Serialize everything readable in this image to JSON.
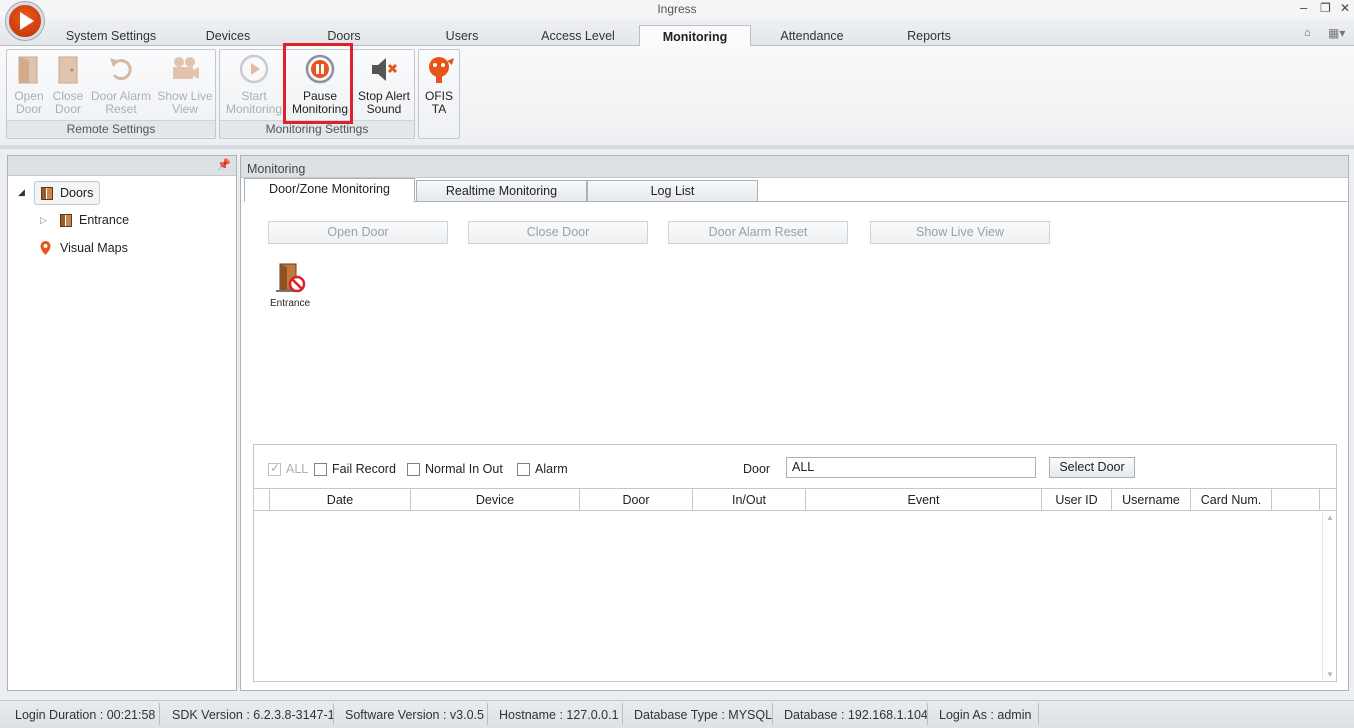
{
  "window": {
    "title": "Ingress",
    "minimize_glyph": "–",
    "restore_glyph": "❐",
    "close_glyph": "✕"
  },
  "ribbon_tabs": [
    "System Settings",
    "Devices",
    "Doors",
    "Users",
    "Access Level",
    "Monitoring",
    "Attendance",
    "Reports"
  ],
  "active_ribbon_tab": "Monitoring",
  "ribbon": {
    "remote_settings": {
      "label": "Remote Settings",
      "buttons": [
        {
          "line1": "Open",
          "line2": "Door",
          "icon": "open-door-icon",
          "enabled": false
        },
        {
          "line1": "Close",
          "line2": "Door",
          "icon": "close-door-icon",
          "enabled": false
        },
        {
          "line1": "Door Alarm",
          "line2": "Reset",
          "icon": "reset-icon",
          "enabled": false
        },
        {
          "line1": "Show Live",
          "line2": "View",
          "icon": "camera-icon",
          "enabled": false
        }
      ]
    },
    "monitoring_settings": {
      "label": "Monitoring Settings",
      "buttons": [
        {
          "line1": "Start",
          "line2": "Monitoring",
          "icon": "play-icon",
          "enabled": false
        },
        {
          "line1": "Pause",
          "line2": "Monitoring",
          "icon": "pause-icon",
          "enabled": true
        },
        {
          "line1": "Stop Alert",
          "line2": "Sound",
          "icon": "mute-icon",
          "enabled": true
        }
      ]
    },
    "ofis": {
      "line1": "OFIS",
      "line2": "TA",
      "icon": "ofis-ta-icon"
    }
  },
  "tree": {
    "root": "Doors",
    "child": "Entrance",
    "maps": "Visual Maps"
  },
  "main": {
    "header": "Monitoring",
    "tabs": [
      "Door/Zone Monitoring",
      "Realtime Monitoring",
      "Log List"
    ],
    "actions": [
      "Open Door",
      "Close Door",
      "Door Alarm Reset",
      "Show Live View"
    ],
    "door_tile": "Entrance",
    "filters": {
      "all": "ALL",
      "fail": "Fail Record",
      "normal": "Normal In Out",
      "alarm": "Alarm",
      "door_label": "Door",
      "door_value": "ALL",
      "select_door": "Select Door"
    },
    "columns": [
      "Date",
      "Device",
      "Door",
      "In/Out",
      "Event",
      "User ID",
      "Username",
      "Card Num."
    ]
  },
  "status": [
    "Login Duration : 00:21:58",
    "SDK Version : 6.2.3.8-3147-1",
    "Software Version : v3.0.5",
    "Hostname : 127.0.0.1",
    "Database Type : MYSQL",
    "Database : 192.168.1.104",
    "Login As : admin"
  ],
  "colors": {
    "highlight": "#e0202a",
    "accent": "#e8541a"
  }
}
